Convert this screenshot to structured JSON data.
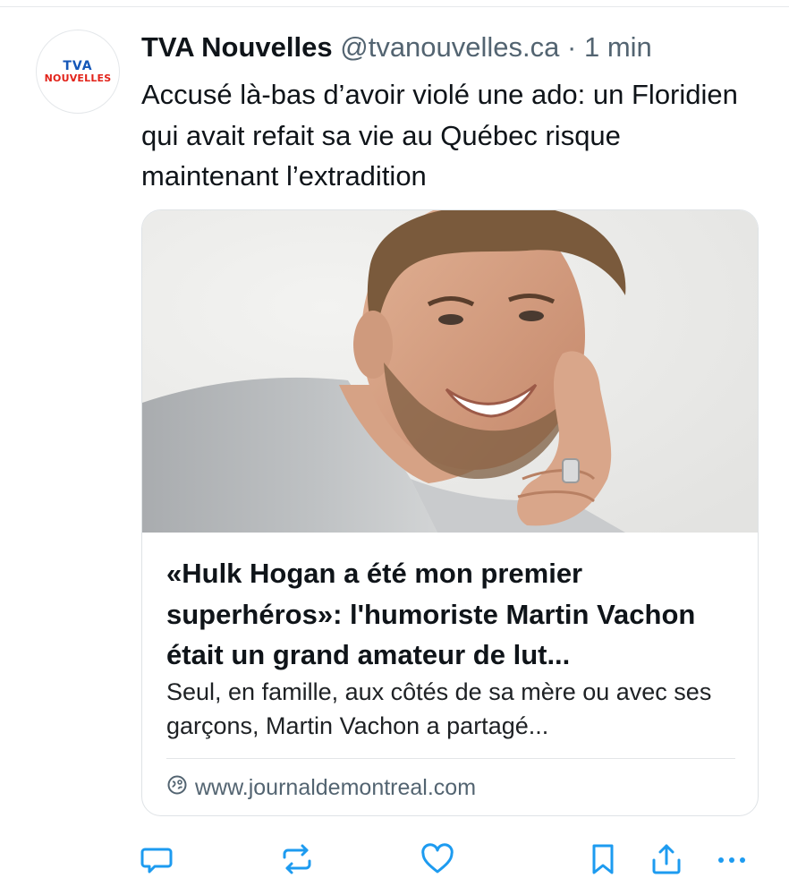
{
  "tweet": {
    "avatar": {
      "logo_top": "TVA",
      "logo_bottom": "NOUVELLES"
    },
    "display_name": "TVA Nouvelles",
    "handle": "@tvanouvelles.ca",
    "separator": "·",
    "time": "1 min",
    "text": "Accusé là-bas d’avoir violé une ado: un Floridien qui avait refait sa vie au Québec risque maintenant l’extradition"
  },
  "card": {
    "image_icon": "smiling-man-photo",
    "title": "«Hulk Hogan a été mon premier superhéros»: l'humoriste Martin Vachon était un grand amateur de lut...",
    "description": "Seul, en famille, aux côtés de sa mère ou avec ses garçons, Martin Vachon a partagé...",
    "domain_icon": "link-globe-icon",
    "domain": "www.journaldemontreal.com"
  },
  "actions": [
    {
      "name": "reply-icon"
    },
    {
      "name": "retweet-icon"
    },
    {
      "name": "like-icon"
    },
    {
      "name": "bookmark-icon"
    },
    {
      "name": "share-icon"
    },
    {
      "name": "more-icon"
    }
  ],
  "colors": {
    "text": "#0f1419",
    "secondary": "#536471",
    "action_icon": "#1d9bf0",
    "logo_blue": "#1557b8",
    "logo_red": "#e2231a"
  }
}
